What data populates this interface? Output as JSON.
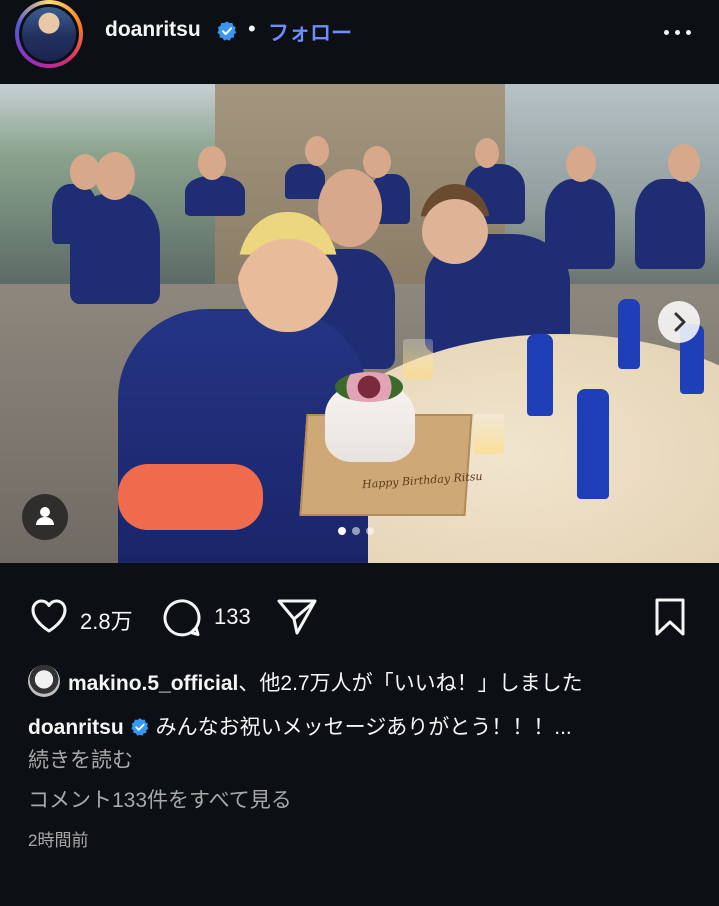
{
  "header": {
    "username": "doanritsu",
    "separator": "•",
    "follow_label": "フォロー"
  },
  "post": {
    "cake_message": "Happy Birthday Ritsu",
    "carousel": {
      "count": 3,
      "active_index": 0
    },
    "actions": {
      "likes_count": "2.8万",
      "comments_count": "133"
    },
    "likes_line": {
      "user": "makino.5_official",
      "rest": "、他2.7万人が「いいね！」しました"
    },
    "caption": {
      "user": "doanritsu",
      "text": "みんなお祝いメッセージありがとう！！！..."
    },
    "read_more_label": "続きを読む",
    "view_comments_label": "コメント133件をすべて見る",
    "time_ago": "2時間前"
  },
  "colors": {
    "background": "#0c1014",
    "accent_blue": "#6c8cff",
    "verified_blue": "#3897f0",
    "muted_text": "#a8a8a8"
  },
  "icons": {
    "verified": "verified-badge-icon",
    "more": "more-options-icon",
    "like": "heart-icon",
    "comment": "comment-bubble-icon",
    "share": "paper-plane-icon",
    "save": "bookmark-icon",
    "next": "chevron-right-icon",
    "tag": "user-tag-icon"
  }
}
